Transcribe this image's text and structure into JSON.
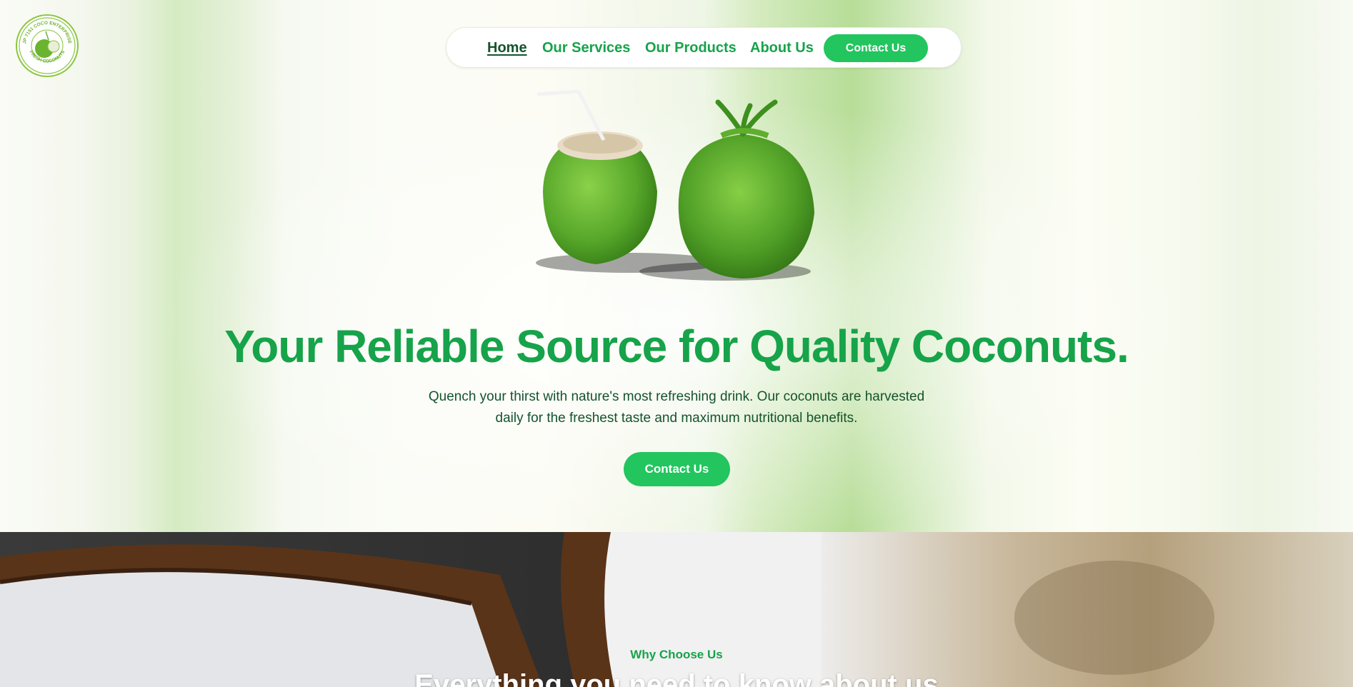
{
  "brand": {
    "logo_text_top": "JP 7151 COCO ENTERPRISE",
    "logo_text_bottom": "FRESH COCONUTS"
  },
  "nav": {
    "items": [
      {
        "label": "Home",
        "active": true
      },
      {
        "label": "Our Services",
        "active": false
      },
      {
        "label": "Our Products",
        "active": false
      },
      {
        "label": "About Us",
        "active": false
      }
    ],
    "cta_label": "Contact Us"
  },
  "hero": {
    "headline": "Your Reliable Source for Quality Coconuts.",
    "subtext": "Quench your thirst with nature's most refreshing drink. Our coconuts are harvested daily for the freshest taste and maximum nutritional benefits.",
    "cta_label": "Contact Us"
  },
  "why": {
    "eyebrow": "Why Choose Us",
    "title": "Everything you need to know about us"
  },
  "colors": {
    "accent": "#16a34a",
    "button": "#22c55e",
    "nav_active": "#14532d"
  }
}
